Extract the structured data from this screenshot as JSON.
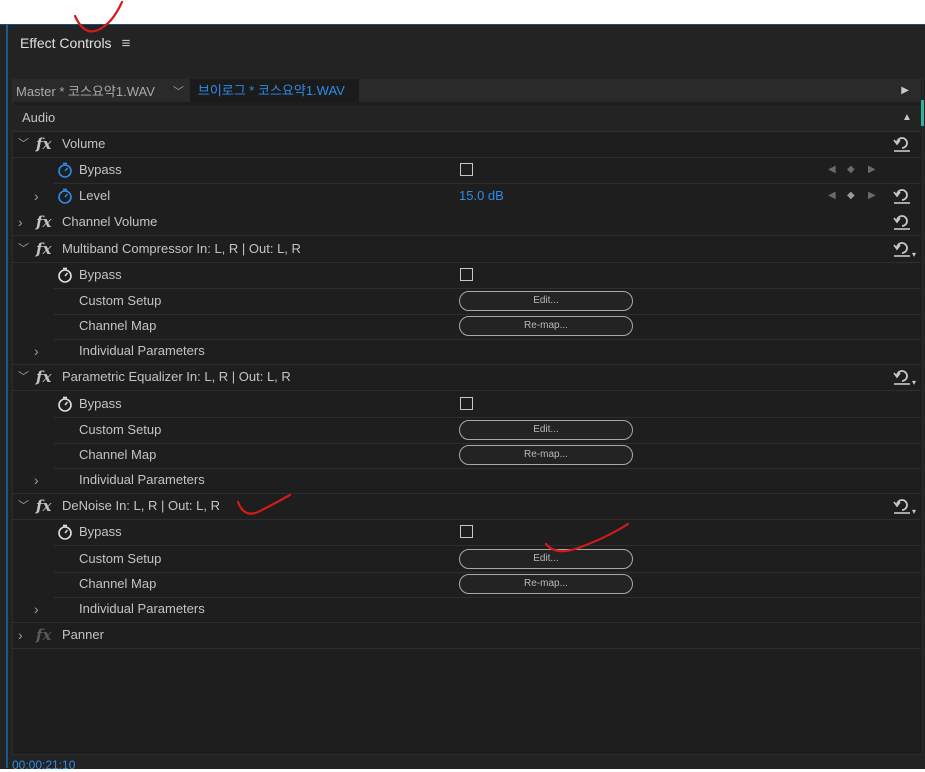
{
  "panel": {
    "title": "Effect Controls",
    "menu_icon": "≡"
  },
  "tabs": {
    "master": "Master * 코스요약1.WAV",
    "clip": "브이로그 * 코스요약1.WAV",
    "chevron": "﹀"
  },
  "section": {
    "label": "Audio"
  },
  "effects": {
    "volume": {
      "name": "Volume",
      "bypass": "Bypass",
      "level_label": "Level",
      "level_value": "15.0 dB"
    },
    "channel_volume": {
      "name": "Channel Volume"
    },
    "multiband": {
      "name": "Multiband Compressor  In: L, R | Out: L, R",
      "bypass": "Bypass",
      "custom_setup": "Custom Setup",
      "channel_map": "Channel Map",
      "individual": "Individual Parameters",
      "edit_btn": "Edit...",
      "remap_btn": "Re-map..."
    },
    "parametric": {
      "name": "Parametric Equalizer  In: L, R | Out: L, R",
      "bypass": "Bypass",
      "custom_setup": "Custom Setup",
      "channel_map": "Channel Map",
      "individual": "Individual Parameters",
      "edit_btn": "Edit...",
      "remap_btn": "Re-map..."
    },
    "denoise": {
      "name": "DeNoise  In: L, R | Out: L, R",
      "bypass": "Bypass",
      "custom_setup": "Custom Setup",
      "channel_map": "Channel Map",
      "individual": "Individual Parameters",
      "edit_btn": "Edit...",
      "remap_btn": "Re-map..."
    },
    "panner": {
      "name": "Panner"
    }
  },
  "glyphs": {
    "fx": "fx",
    "collapse": "﹀",
    "expand": "›",
    "kf_prev": "◀",
    "kf_add": "◆",
    "kf_next": "▶",
    "scroll_up": "▲",
    "play": "▶"
  },
  "footer": {
    "timecode": "00:00:21:10"
  },
  "colors": {
    "accent_blue": "#2d8ceb",
    "panel_bg": "#232323",
    "annotation_red": "#d31a1a"
  }
}
